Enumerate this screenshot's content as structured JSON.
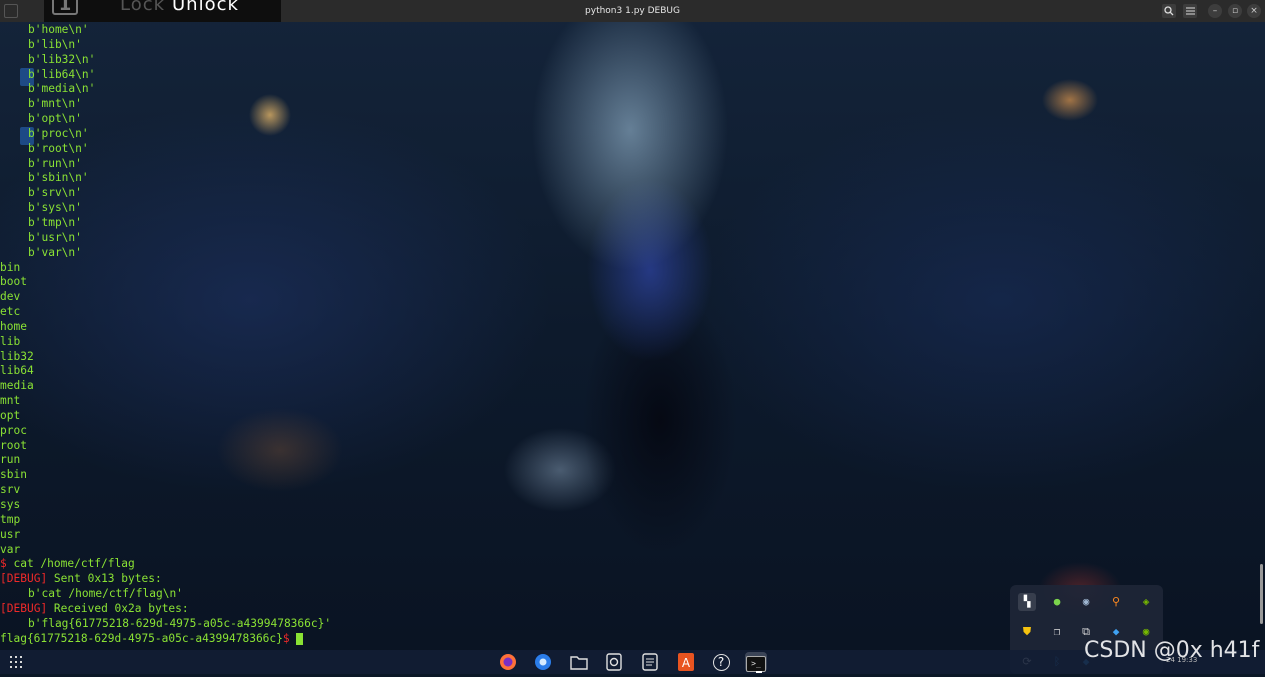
{
  "window": {
    "title": "python3 1.py DEBUG",
    "lock_number": "1",
    "lock_label": "Lock",
    "unlock_label": "Unlock",
    "icons": [
      "menu-icon",
      "search-icon",
      "hamburger-icon",
      "minimize-icon",
      "maximize-icon",
      "close-icon"
    ]
  },
  "terminal": {
    "byte_lines": [
      "b'home\\n'",
      "b'lib\\n'",
      "b'lib32\\n'",
      "b'lib64\\n'",
      "b'media\\n'",
      "b'mnt\\n'",
      "b'opt\\n'",
      "b'proc\\n'",
      "b'root\\n'",
      "b'run\\n'",
      "b'sbin\\n'",
      "b'srv\\n'",
      "b'sys\\n'",
      "b'tmp\\n'",
      "b'usr\\n'",
      "b'var\\n'"
    ],
    "listing": [
      "bin",
      "boot",
      "dev",
      "etc",
      "home",
      "lib",
      "lib32",
      "lib64",
      "media",
      "mnt",
      "opt",
      "proc",
      "root",
      "run",
      "sbin",
      "srv",
      "sys",
      "tmp",
      "usr",
      "var"
    ],
    "prompt_symbol": "$",
    "command": " cat /home/ctf/flag",
    "debug_open": "[",
    "debug_tag": "DEBUG",
    "debug_close": "]",
    "sent_msg": " Sent 0x13 bytes:",
    "sent_data": "b'cat /home/ctf/flag\\n'",
    "recv_msg": " Received 0x2a bytes:",
    "recv_data": "b'flag{61775218-629d-4975-a05c-a4399478366c}'",
    "flag_output": "flag{61775218-629d-4975-a05c-a4399478366c}",
    "final_prompt": "$ "
  },
  "dock": {
    "apps": [
      "apps-grid-icon",
      "firefox-icon",
      "browser-icon",
      "files-icon",
      "media-icon",
      "text-editor-icon",
      "app-store-icon",
      "help-icon",
      "terminal-icon"
    ],
    "help_glyph": "?",
    "terminal_glyph": ">_"
  },
  "tray": {
    "clock": "24 19:33",
    "icons": [
      "pin-icon",
      "wechat-icon",
      "steam-icon",
      "search-tool-icon",
      "nvidia-icon",
      "shield-icon",
      "copy-icon",
      "screenshot-icon",
      "vscode-icon",
      "nvidia-settings-icon",
      "sync-icon",
      "bluetooth-icon",
      "vpn-icon"
    ]
  },
  "watermark": "CSDN @0x h41f",
  "colors": {
    "terminal_green": "#8ae234",
    "debug_red": "#ef2929",
    "titlebar_bg": "#2b2b2b"
  }
}
